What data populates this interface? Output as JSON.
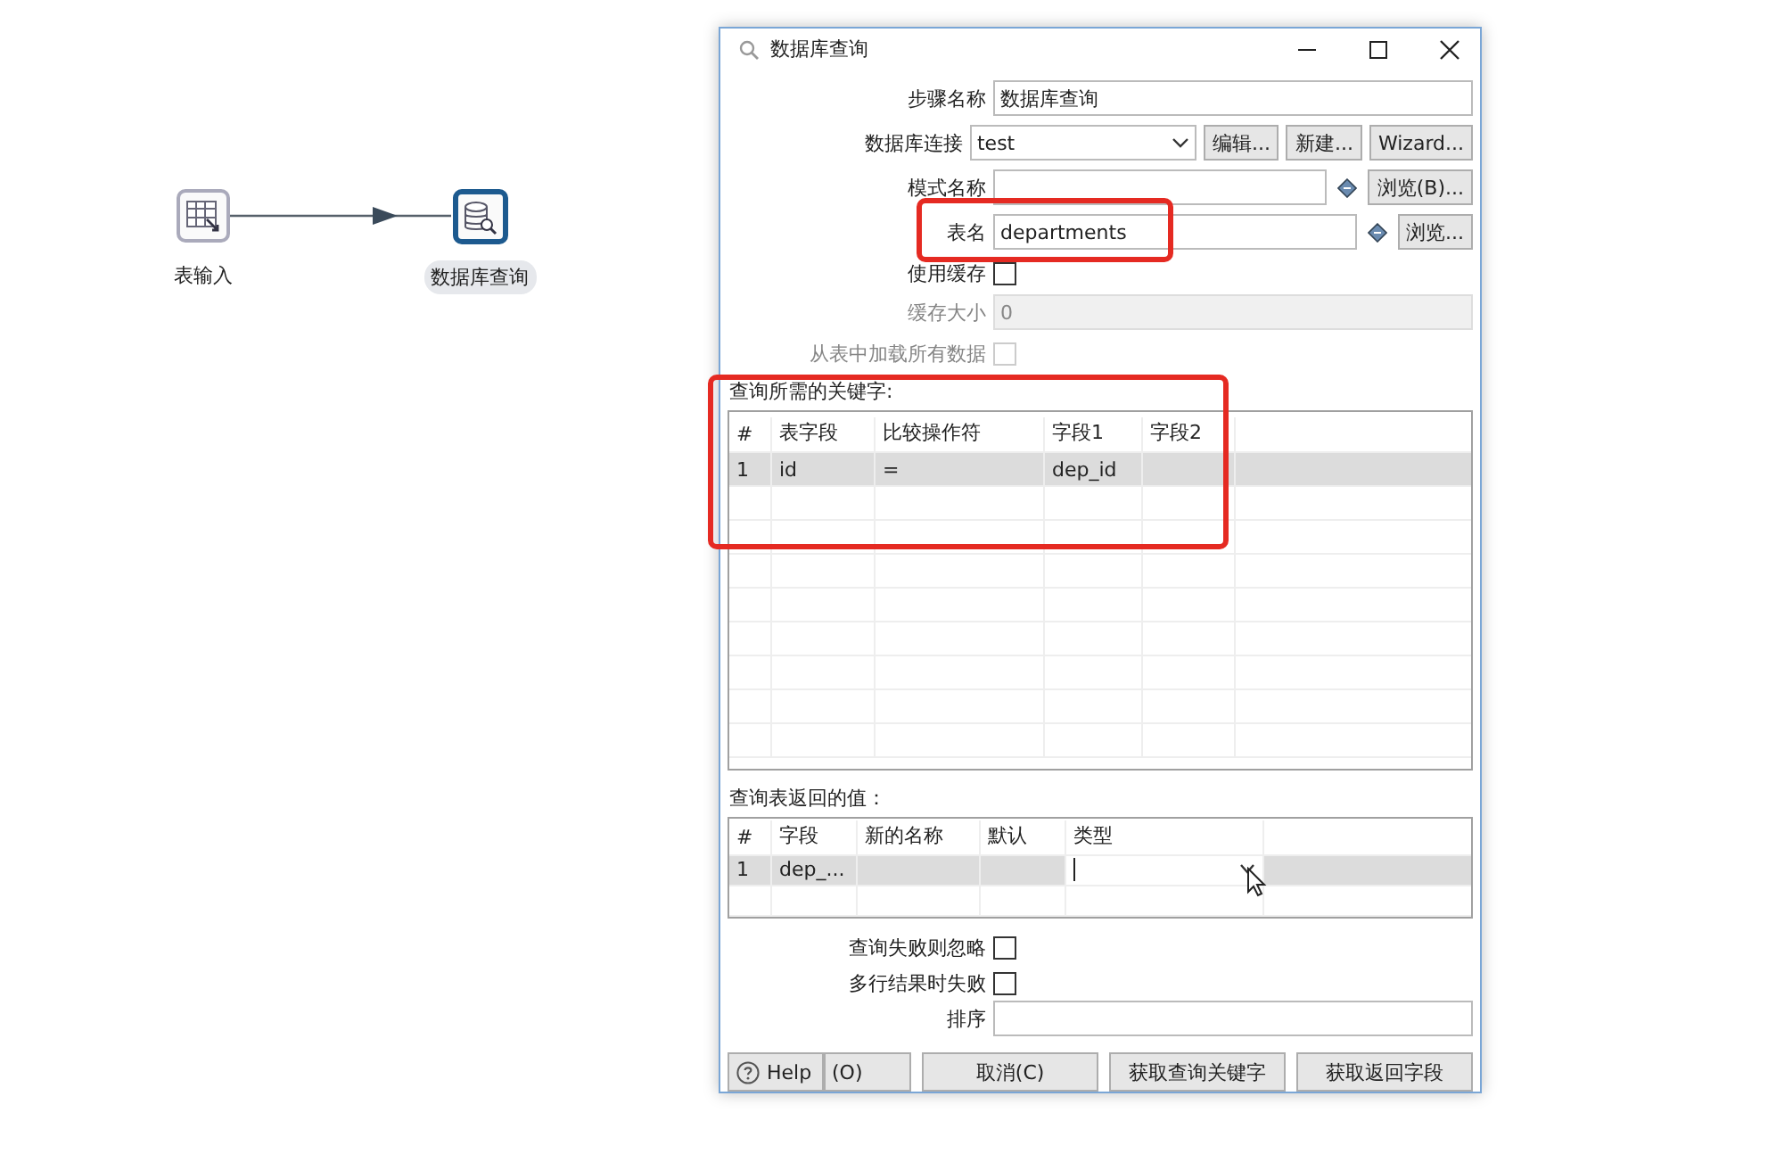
{
  "canvas": {
    "nodes": [
      {
        "label": "表输入",
        "kind": "table-input",
        "selected": false
      },
      {
        "label": "数据库查询",
        "kind": "db-lookup",
        "selected": true
      }
    ]
  },
  "dialog": {
    "title": "数据库查询",
    "fields": [
      {
        "kind": "text",
        "label": "步骤名称",
        "value": "数据库查询"
      },
      {
        "kind": "select",
        "label": "数据库连接",
        "value": "test",
        "buttons": [
          "编辑...",
          "新建...",
          "Wizard..."
        ]
      },
      {
        "kind": "text",
        "label": "模式名称",
        "variable": true,
        "buttons": [
          "浏览(B)..."
        ]
      },
      {
        "kind": "text",
        "label": "表名",
        "value": "departments",
        "variable": true,
        "buttons": [
          "浏览..."
        ]
      },
      {
        "kind": "checkbox",
        "label": "使用缓存",
        "checked": false,
        "disabled": false
      },
      {
        "kind": "text",
        "label": "缓存大小",
        "value": "0",
        "disabled": true
      },
      {
        "kind": "checkbox",
        "label": "从表中加载所有数据",
        "checked": false,
        "disabled": true
      }
    ],
    "key_table": {
      "title": "查询所需的关键字:",
      "columns": [
        "#",
        "表字段",
        "比较操作符",
        "字段1",
        "字段2"
      ],
      "rows": [
        {
          "number": "1",
          "table_field": "id",
          "comparator": "=",
          "field_1": "dep_id",
          "selected": true
        }
      ]
    },
    "return_table": {
      "title": "查询表返回的值：",
      "columns": [
        "#",
        "字段",
        "新的名称",
        "默认",
        "类型"
      ],
      "rows": [
        {
          "number": "1",
          "field": "dep_...",
          "selected": true
        }
      ]
    },
    "options": [
      {
        "label": "查询失败则忽略",
        "checked": false
      },
      {
        "label": "多行结果时失败",
        "checked": false
      }
    ],
    "sort": {
      "label": "排序"
    },
    "buttons": [
      {
        "kind": "help",
        "label": "Help"
      },
      {
        "kind": "plain",
        "label": "(O)"
      },
      {
        "kind": "plain",
        "label": "取消(C)"
      },
      {
        "kind": "plain",
        "label": "获取查询关键字"
      },
      {
        "kind": "plain",
        "label": "获取返回字段"
      }
    ]
  }
}
